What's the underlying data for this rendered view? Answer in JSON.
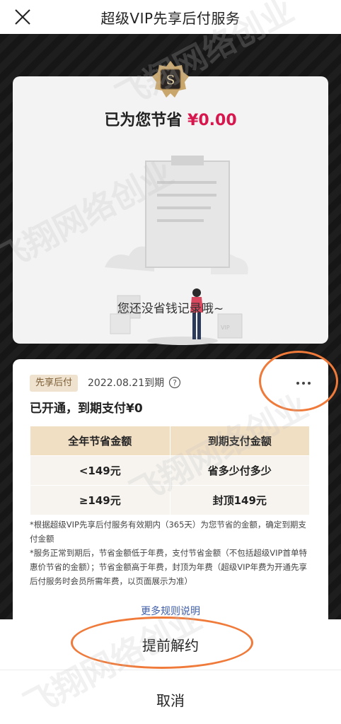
{
  "header": {
    "title": "超级VIP先享后付服务"
  },
  "savings": {
    "label": "已为您节省",
    "amount": "¥0.00",
    "empty_text": "您还没省钱记录哦~"
  },
  "service": {
    "tag": "先享后付",
    "due_date": "2022.08.21到期",
    "status": "已开通，到期支付¥0",
    "table": {
      "headers": [
        "全年节省金额",
        "到期支付金额"
      ],
      "rows": [
        [
          "<149元",
          "省多少付多少"
        ],
        [
          "≥149元",
          "封顶149元"
        ]
      ]
    },
    "notes": [
      "*根据超级VIP先享后付服务有效期内（365天）为您节省的金额，确定到期支付金额",
      "*服务正常到期后，节省金额低于年费，支付节省金额（不包括超级VIP首单特惠价节省的金额）；节省金额高于年费，封顶为年费（超级VIP年费为开通先享后付服务时会员所需年费，以页面展示为准）"
    ],
    "rules_link": "更多规则说明"
  },
  "sheet": {
    "terminate_label": "提前解约",
    "cancel_label": "取消"
  },
  "watermark": {
    "text": "飞翔网络创业"
  },
  "colors": {
    "accent_red": "#d6164c",
    "annotation": "#ef7a3a",
    "tag_bg": "#efe3cf",
    "table_header": "#f1dfc4"
  },
  "icons": [
    "close-icon",
    "s-badge-icon",
    "help-icon",
    "more-icon"
  ]
}
